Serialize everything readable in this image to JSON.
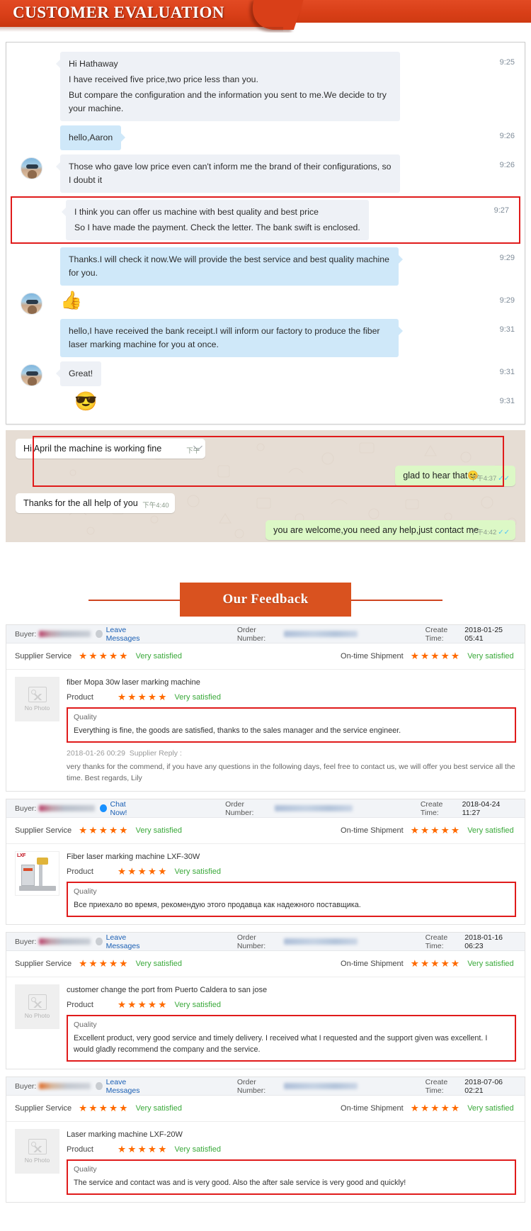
{
  "header": {
    "title": "CUSTOMER EVALUATION",
    "accent": "#d93f18"
  },
  "chat": {
    "messages": [
      {
        "side": "in",
        "avatar": false,
        "time": "9:25",
        "highlight": false,
        "lines": [
          "Hi Hathaway",
          "I have received five price,two price less than you.",
          "But compare the configuration and the information you sent to me.We decide to try your machine."
        ]
      },
      {
        "side": "out",
        "avatar": false,
        "time": "9:26",
        "highlight": false,
        "lines": [
          "hello,Aaron"
        ]
      },
      {
        "side": "in",
        "avatar": true,
        "time": "9:26",
        "highlight": false,
        "lines": [
          "Those who gave low price even can't inform me the brand of their configurations, so I doubt it"
        ]
      },
      {
        "side": "in",
        "avatar": false,
        "time": "9:27",
        "highlight": true,
        "lines": [
          "I think you can offer us machine with best quality and best price",
          "So I have made the payment. Check the letter. The bank swift is enclosed."
        ]
      },
      {
        "side": "out",
        "avatar": false,
        "time": "9:29",
        "highlight": false,
        "lines": [
          "Thanks.I will check it now.We will provide the best service and best quality machine for you."
        ]
      },
      {
        "side": "in",
        "avatar": true,
        "time": "9:29",
        "highlight": false,
        "emoji": "👍",
        "lines": []
      },
      {
        "side": "out",
        "avatar": false,
        "time": "9:31",
        "highlight": false,
        "lines": [
          "hello,I have received the bank receipt.I will inform our factory to produce the fiber laser marking machine for you at once."
        ]
      },
      {
        "side": "in",
        "avatar": true,
        "time": "9:31",
        "highlight": false,
        "lines": [
          "Great!"
        ]
      },
      {
        "side": "out",
        "avatar": false,
        "time": "9:31",
        "highlight": false,
        "emoji": "😎",
        "lines": []
      }
    ]
  },
  "whatsapp": {
    "messages": [
      {
        "side": "left",
        "text": "Hi April the machine is working fine",
        "time": "下午",
        "ticks": ""
      },
      {
        "side": "right",
        "text": "glad to hear that😊",
        "time": "下午4:37",
        "ticks": "✓✓"
      },
      {
        "side": "left",
        "text": "Thanks for the all help of you",
        "time": "下午4:40",
        "ticks": ""
      },
      {
        "side": "right",
        "text": "you are welcome,you need any help,just contact me",
        "time": "下午4:42",
        "ticks": "✓✓"
      }
    ]
  },
  "feedback_header": {
    "title": "Our Feedback"
  },
  "labels": {
    "buyer": "Buyer:",
    "order_number": "Order Number:",
    "create_time": "Create Time:",
    "supplier_service": "Supplier Service",
    "on_time_shipment": "On-time Shipment",
    "product": "Product",
    "quality": "Quality",
    "no_photo": "No Photo",
    "stars": "★★★★★",
    "satisfied": "Very satisfied",
    "supplier_reply": "Supplier Reply :"
  },
  "cards": [
    {
      "contact_action": "Leave Messages",
      "contact_style": "grey",
      "create_time": "2018-01-25 05:41",
      "service_rating": "Very satisfied",
      "shipment_rating": "Very satisfied",
      "product_title": "fiber Mopa 30w laser marking machine",
      "product_rating": "Very satisfied",
      "thumb": "no-photo",
      "quality_text": "Everything is fine, the goods are satisfied, thanks to the sales manager and the service engineer.",
      "reply_time": "2018-01-26 00:29",
      "reply_text": "very thanks for the commend, if you have any questions in the following days, feel free to contact us, we will offer you best service all the time. Best regards, Lily"
    },
    {
      "contact_action": "Chat Now!",
      "contact_style": "blue",
      "create_time": "2018-04-24 11:27",
      "service_rating": "Very satisfied",
      "shipment_rating": "Very satisfied",
      "product_title": "Fiber laser marking machine LXF-30W",
      "product_rating": "Very satisfied",
      "thumb": "machine",
      "quality_text": "Все приехало во время, рекомендую этого продавца как надежного поставщика.",
      "reply_time": "",
      "reply_text": ""
    },
    {
      "contact_action": "Leave Messages",
      "contact_style": "grey",
      "create_time": "2018-01-16 06:23",
      "service_rating": "Very satisfied",
      "shipment_rating": "Very satisfied",
      "product_title": "customer change the port from Puerto Caldera to san jose",
      "product_rating": "Very satisfied",
      "thumb": "no-photo",
      "quality_text": "Excellent product, very good service and timely delivery. I received what I requested and the support given was excellent. I would gladly recommend the company and the service.",
      "reply_time": "",
      "reply_text": ""
    },
    {
      "contact_action": "Leave Messages",
      "contact_style": "grey-orange",
      "create_time": "2018-07-06 02:21",
      "service_rating": "Very satisfied",
      "shipment_rating": "Very satisfied",
      "product_title": "Laser marking machine LXF-20W",
      "product_rating": "Very satisfied",
      "thumb": "no-photo",
      "quality_text": "The service and contact was and is very good. Also the after sale service is very good and quickly!",
      "reply_time": "",
      "reply_text": ""
    }
  ]
}
